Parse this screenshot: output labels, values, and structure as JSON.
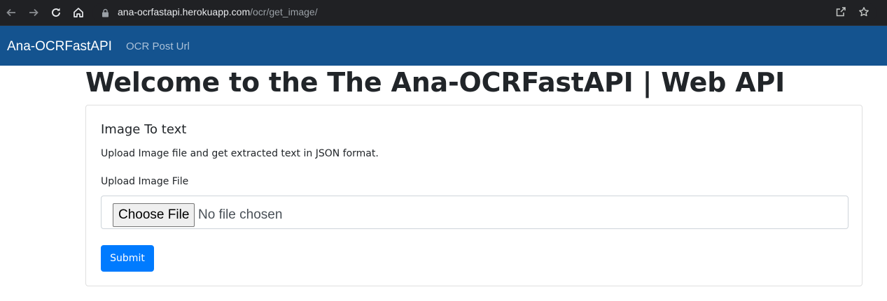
{
  "browser": {
    "url_host": "ana-ocrfastapi.herokuapp.com",
    "url_path": "/ocr/get_image/",
    "icons": [
      "back-arrow-icon",
      "forward-arrow-icon",
      "reload-icon",
      "home-icon",
      "lock-icon",
      "share-icon",
      "bookmark-star-icon"
    ]
  },
  "navbar": {
    "brand": "Ana-OCRFastAPI",
    "link": "OCR Post Url",
    "bg_color": "#14538f"
  },
  "main": {
    "title": "Welcome to the The Ana-OCRFastAPI | Web API"
  },
  "card": {
    "title": "Image To text",
    "description": "Upload Image file and get extracted text in JSON format.",
    "field_label": "Upload Image File",
    "choose_button": "Choose File",
    "file_status": "No file chosen",
    "submit_label": "Submit",
    "submit_color": "#007bff"
  }
}
